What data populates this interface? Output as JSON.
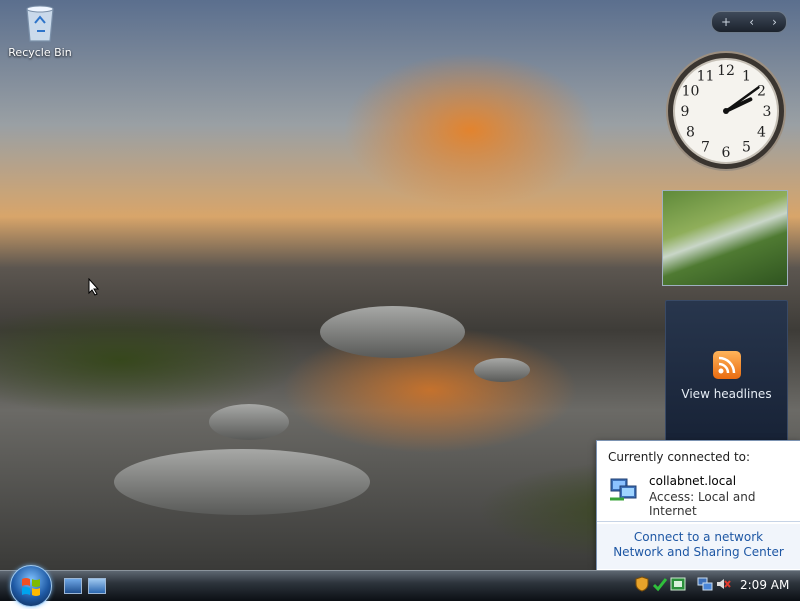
{
  "desktop": {
    "icons": [
      {
        "label": "Recycle Bin",
        "icon": "recycle-bin-icon"
      }
    ]
  },
  "sidebar": {
    "controls": {
      "add": "+",
      "prev": "‹",
      "next": "›"
    },
    "clock": {
      "time": "2:09",
      "numerals": [
        "12",
        "1",
        "2",
        "3",
        "4",
        "5",
        "6",
        "7",
        "8",
        "9",
        "10",
        "11"
      ]
    },
    "slideshow": {
      "icon": "slideshow-image"
    },
    "feed": {
      "label": "View headlines",
      "icon": "rss-icon"
    }
  },
  "network_popup": {
    "heading": "Currently connected to:",
    "network_name": "collabnet.local",
    "access": "Access:  Local and Internet",
    "link_connect": "Connect to a network",
    "link_sharing": "Network and Sharing Center"
  },
  "taskbar": {
    "clock": "2:09 AM",
    "quick_launch": [
      "show-desktop-icon",
      "switch-windows-icon"
    ],
    "tray_icons": [
      "windows-defender-icon",
      "security-center-icon",
      "tray-app-icon",
      "network-icon",
      "volume-muted-icon"
    ]
  }
}
